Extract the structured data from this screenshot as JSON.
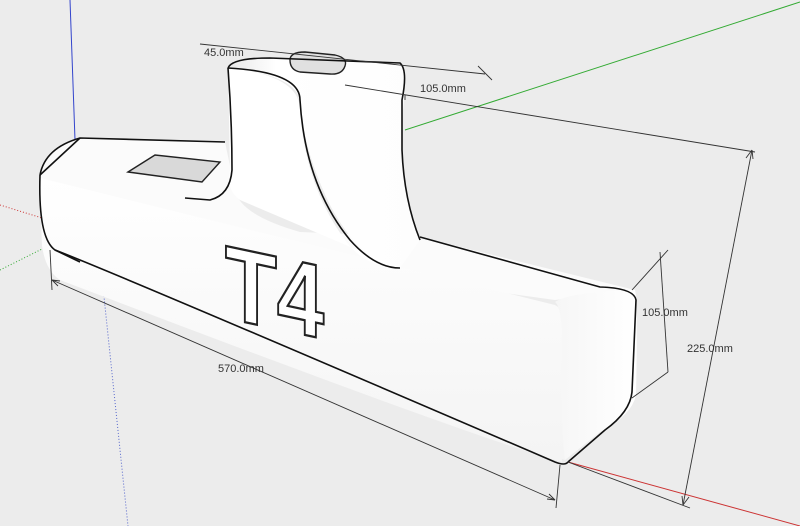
{
  "scene": {
    "background_color": "#ececec",
    "model_color": "#ffffff",
    "axis_colors": {
      "green_axis": "#33aa33",
      "red_axis": "#cc3333",
      "blue_axis": "#3344cc"
    }
  },
  "model": {
    "engraved_text": "T4"
  },
  "dimensions": {
    "top_width": "45.0mm",
    "top_depth": "105.0mm",
    "side_height": "105.0mm",
    "total_height": "225.0mm",
    "length": "570.0mm"
  }
}
